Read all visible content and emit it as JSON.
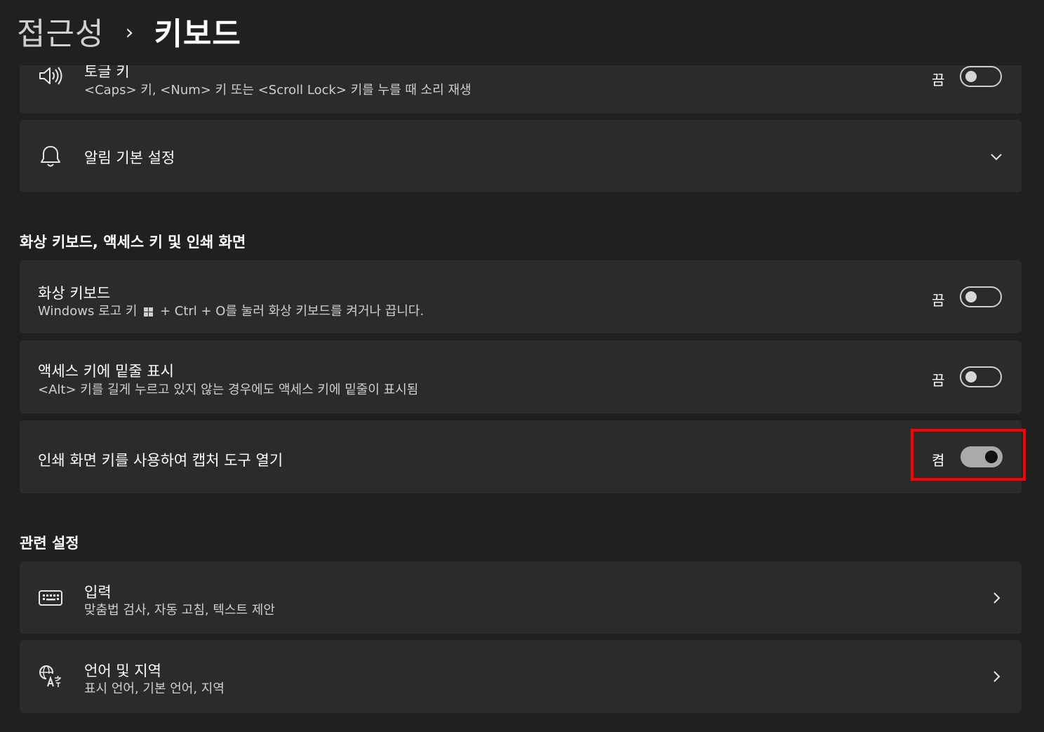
{
  "breadcrumb": {
    "parent": "접근성",
    "separator": "›",
    "current": "키보드"
  },
  "toggle_keys": {
    "title": "토글 키",
    "description": "<Caps> 키, <Num> 키 또는 <Scroll Lock> 키를 누를 때 소리 재생",
    "state_label": "끔",
    "state": false,
    "icon": "speaker-icon"
  },
  "notification_prefs": {
    "title": "알림 기본 설정",
    "icon": "bell-icon",
    "expand_icon": "chevron-down-icon"
  },
  "section_osk": {
    "title": "화상 키보드, 액세스 키 및 인쇄 화면"
  },
  "on_screen_keyboard": {
    "title": "화상 키보드",
    "description_prefix": "Windows 로고 키",
    "description_suffix": "+ Ctrl + O를 눌러 화상 키보드를 켜거나 끕니다.",
    "state_label": "끔",
    "state": false
  },
  "access_key_underline": {
    "title": "액세스 키에 밑줄 표시",
    "description": "<Alt> 키를 길게 누르고 있지 않는 경우에도 액세스 키에 밑줄이 표시됨",
    "state_label": "끔",
    "state": false
  },
  "print_screen": {
    "title": "인쇄 화면 키를 사용하여 캡처 도구 열기",
    "state_label": "켬",
    "state": true
  },
  "section_related": {
    "title": "관련 설정"
  },
  "typing": {
    "title": "입력",
    "description": "맞춤법 검사, 자동 고침, 텍스트 제안",
    "icon": "keyboard-icon"
  },
  "language_region": {
    "title": "언어 및 지역",
    "description": "표시 언어, 기본 언어, 지역",
    "icon": "language-icon"
  },
  "colors": {
    "background": "#202020",
    "card": "#2b2b2b",
    "highlight": "#ff0000",
    "toggle_on": "#aaaaaa"
  }
}
